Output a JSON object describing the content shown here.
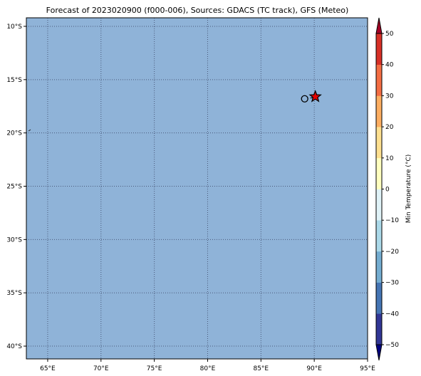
{
  "title": "Forecast of 2023020900 (f000-006), Sources: GDACS (TC track), GFS (Meteo)",
  "map": {
    "extent": {
      "lon": [
        63,
        95
      ],
      "lat": [
        -41.2,
        -9.2
      ]
    },
    "lon_ticks": [
      {
        "value": 65,
        "label": "65°E"
      },
      {
        "value": 70,
        "label": "70°E"
      },
      {
        "value": 75,
        "label": "75°E"
      },
      {
        "value": 80,
        "label": "80°E"
      },
      {
        "value": 85,
        "label": "85°E"
      },
      {
        "value": 90,
        "label": "90°E"
      },
      {
        "value": 95,
        "label": "95°E"
      }
    ],
    "lat_ticks": [
      {
        "value": -10,
        "label": "10°S"
      },
      {
        "value": -15,
        "label": "15°S"
      },
      {
        "value": -20,
        "label": "20°S"
      },
      {
        "value": -25,
        "label": "25°S"
      },
      {
        "value": -30,
        "label": "30°S"
      },
      {
        "value": -35,
        "label": "35°S"
      },
      {
        "value": -40,
        "label": "40°S"
      }
    ],
    "ocean_color": "#8fb3d8",
    "grid": true,
    "track": {
      "circle": {
        "lon": 89.1,
        "lat": -16.8
      },
      "star": {
        "lon": 90.1,
        "lat": -16.6,
        "color": "#e60000"
      }
    }
  },
  "colorbar": {
    "label": "Min Temperature (°C)",
    "levels": [
      -50,
      -40,
      -30,
      -20,
      -10,
      0,
      10,
      20,
      30,
      40,
      50
    ],
    "tick_labels": [
      "−50",
      "−40",
      "−30",
      "−20",
      "−10",
      "0",
      "10",
      "20",
      "30",
      "40",
      "50"
    ],
    "colors": [
      "#313695",
      "#4575b4",
      "#74add1",
      "#abd9e9",
      "#e0f3f8",
      "#ffffbf",
      "#fee090",
      "#fdae61",
      "#f46d43",
      "#d73027"
    ],
    "under_color": "#000080",
    "over_color": "#a50026",
    "extend": "both"
  }
}
